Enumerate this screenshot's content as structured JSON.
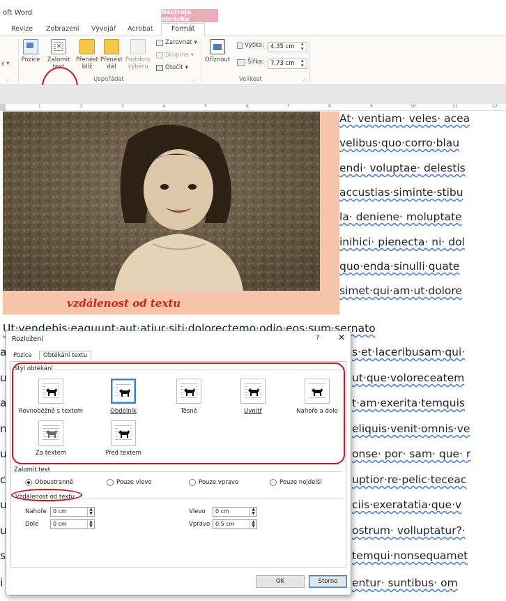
{
  "app": {
    "title": "oft Word"
  },
  "ribbon": {
    "context_header": "Nástroje obrázku",
    "tabs": [
      "Revize",
      "Zobrazení",
      "Vývojář",
      "Acrobat",
      "Formát"
    ],
    "buttons": {
      "pozice": "Pozice",
      "zalomit_l1": "Zalomit",
      "zalomit_l2": "text",
      "prenest_bliz_l1": "Přenést",
      "prenest_bliz_l2": "blíž",
      "prenest_dal_l1": "Přenést",
      "prenest_dal_l2": "dál",
      "podokno_l1": "Podokno",
      "podokno_l2": "výběru",
      "zarovnat": "Zarovnat",
      "skupina": "Skupina",
      "otocit": "Otočit",
      "oriznout": "Oříznout",
      "vyska_label": "Výška:",
      "vyska_value": "4,35 cm",
      "sirka_label": "Šířka:",
      "sirka_value": "7,73 cm"
    },
    "groups": {
      "usporadat": "Uspořádat",
      "velikost": "Velikost"
    },
    "colors": {
      "context_header": "#e9aeb7",
      "highlight_ring": "#d0141e"
    }
  },
  "ruler": {
    "numbers": [
      "1",
      "2",
      "3",
      "4",
      "5",
      "6",
      "7",
      "8",
      "9",
      "10",
      "11",
      "12"
    ]
  },
  "document": {
    "caption": "vzdálenost od textu",
    "lines_right": [
      "At· ventiam· veles· acea",
      "velibus·quo·corro·blau",
      "endi· voluptae· delestis",
      "accustias·siminte·stibu",
      "la· deniene· moluptate",
      "inihici· pienecta· ni· dol",
      "quo·enda·sinulli·quate",
      "simet·qui·am·ut·dolore"
    ],
    "full_line": "Ut·vendebis·eaquunt·aut·atiur·siti·dolorectemo·odio·eos·sum·sernato",
    "lines_after": [
      "s·et·laceribusam·qui·",
      "ut·que·voloreceatem",
      "t·am·exerita·temquis",
      "eliquis·venit·omnis·ve",
      "onse· por· sam· que· r",
      "uptior·re·pelic·teceac",
      "ciis·exeratatia·que·v",
      "ostrum· volluptatur?·",
      "temqui·nonsequamet",
      "entur· suntibus· om"
    ],
    "left_peek": [
      "a",
      "u",
      "a",
      "n",
      "u",
      "c",
      "u",
      "u",
      "s",
      "i"
    ]
  },
  "dialog": {
    "title": "Rozložení",
    "help": "?",
    "close": "✕",
    "tabs": [
      "Pozice",
      "Obtékání textu"
    ],
    "styl_label": "Styl obtékání",
    "styles": [
      "Rovnoběžně s textem",
      "Obdélník",
      "Těsně",
      "Uvnitř",
      "Nahoře a dole",
      "Za textem",
      "Před textem"
    ],
    "selected_style": "Obdélník",
    "zalomit_label": "Zalomit text",
    "zalomit_options": [
      "Oboustranně",
      "Pouze vlevo",
      "Pouze vpravo",
      "Pouze nejdelší"
    ],
    "zalomit_selected": "Oboustranně",
    "vzdalenost_label": "Vzdálenost od textu",
    "distances": {
      "nahore_label": "Nahoře",
      "nahore_value": "0 cm",
      "dole_label": "Dole",
      "dole_value": "0 cm",
      "vlevo_label": "Vlevo",
      "vlevo_value": "0 cm",
      "vpravo_label": "Vpravo",
      "vpravo_value": "0,5 cm"
    },
    "ok": "OK",
    "storno": "Storno"
  }
}
